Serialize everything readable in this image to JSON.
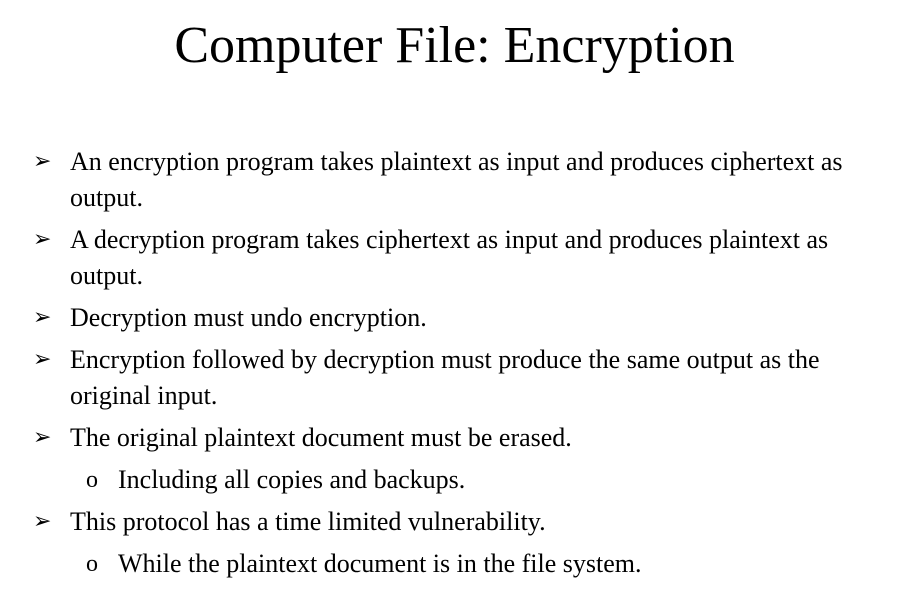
{
  "title": "Computer File: Encryption",
  "bullet_marker": "➢",
  "sub_marker": "o",
  "bullets": [
    "An encryption program takes plaintext as input and produces ciphertext as output.",
    "A decryption program takes ciphertext as input and produces plaintext as output.",
    "Decryption must undo encryption.",
    "Encryption followed by decryption must produce the same output as the original input.",
    "The original plaintext document must be erased.",
    "This protocol has a time limited vulnerability."
  ],
  "sub_bullets": [
    "Including all copies and backups.",
    "While the plaintext document is in the file system."
  ]
}
